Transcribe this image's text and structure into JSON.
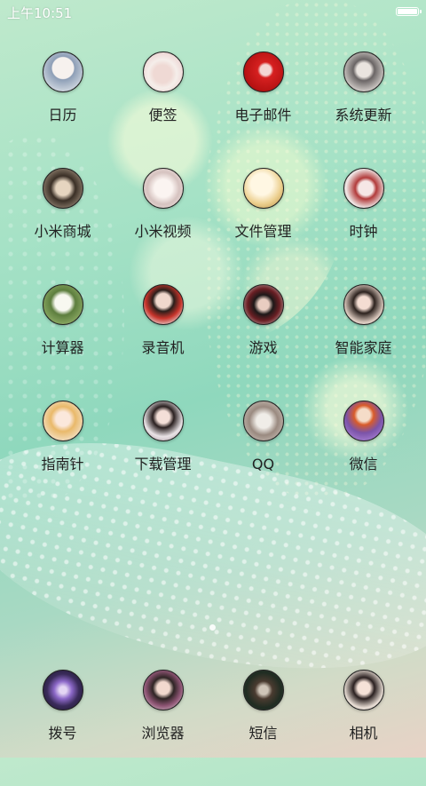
{
  "status_bar": {
    "time": "上午10:51",
    "battery_level": 0.95
  },
  "grid": {
    "rows": [
      [
        {
          "label": "日历",
          "icon": "portrait-photo"
        },
        {
          "label": "便签",
          "icon": "portrait-photo"
        },
        {
          "label": "电子邮件",
          "icon": "portrait-photo"
        },
        {
          "label": "系统更新",
          "icon": "portrait-photo"
        }
      ],
      [
        {
          "label": "小米商城",
          "icon": "portrait-photo"
        },
        {
          "label": "小米视频",
          "icon": "portrait-photo"
        },
        {
          "label": "文件管理",
          "icon": "portrait-photo"
        },
        {
          "label": "时钟",
          "icon": "portrait-photo"
        }
      ],
      [
        {
          "label": "计算器",
          "icon": "portrait-photo"
        },
        {
          "label": "录音机",
          "icon": "portrait-photo"
        },
        {
          "label": "游戏",
          "icon": "portrait-photo"
        },
        {
          "label": "智能家庭",
          "icon": "portrait-photo"
        }
      ],
      [
        {
          "label": "指南针",
          "icon": "portrait-photo"
        },
        {
          "label": "下载管理",
          "icon": "portrait-photo"
        },
        {
          "label": "QQ",
          "icon": "portrait-photo"
        },
        {
          "label": "微信",
          "icon": "portrait-photo"
        }
      ]
    ]
  },
  "page_indicator": {
    "current": 1,
    "total": 1
  },
  "dock": {
    "items": [
      {
        "label": "拨号",
        "icon": "portrait-photo"
      },
      {
        "label": "浏览器",
        "icon": "portrait-photo"
      },
      {
        "label": "短信",
        "icon": "portrait-photo"
      },
      {
        "label": "相机",
        "icon": "portrait-photo"
      }
    ]
  }
}
